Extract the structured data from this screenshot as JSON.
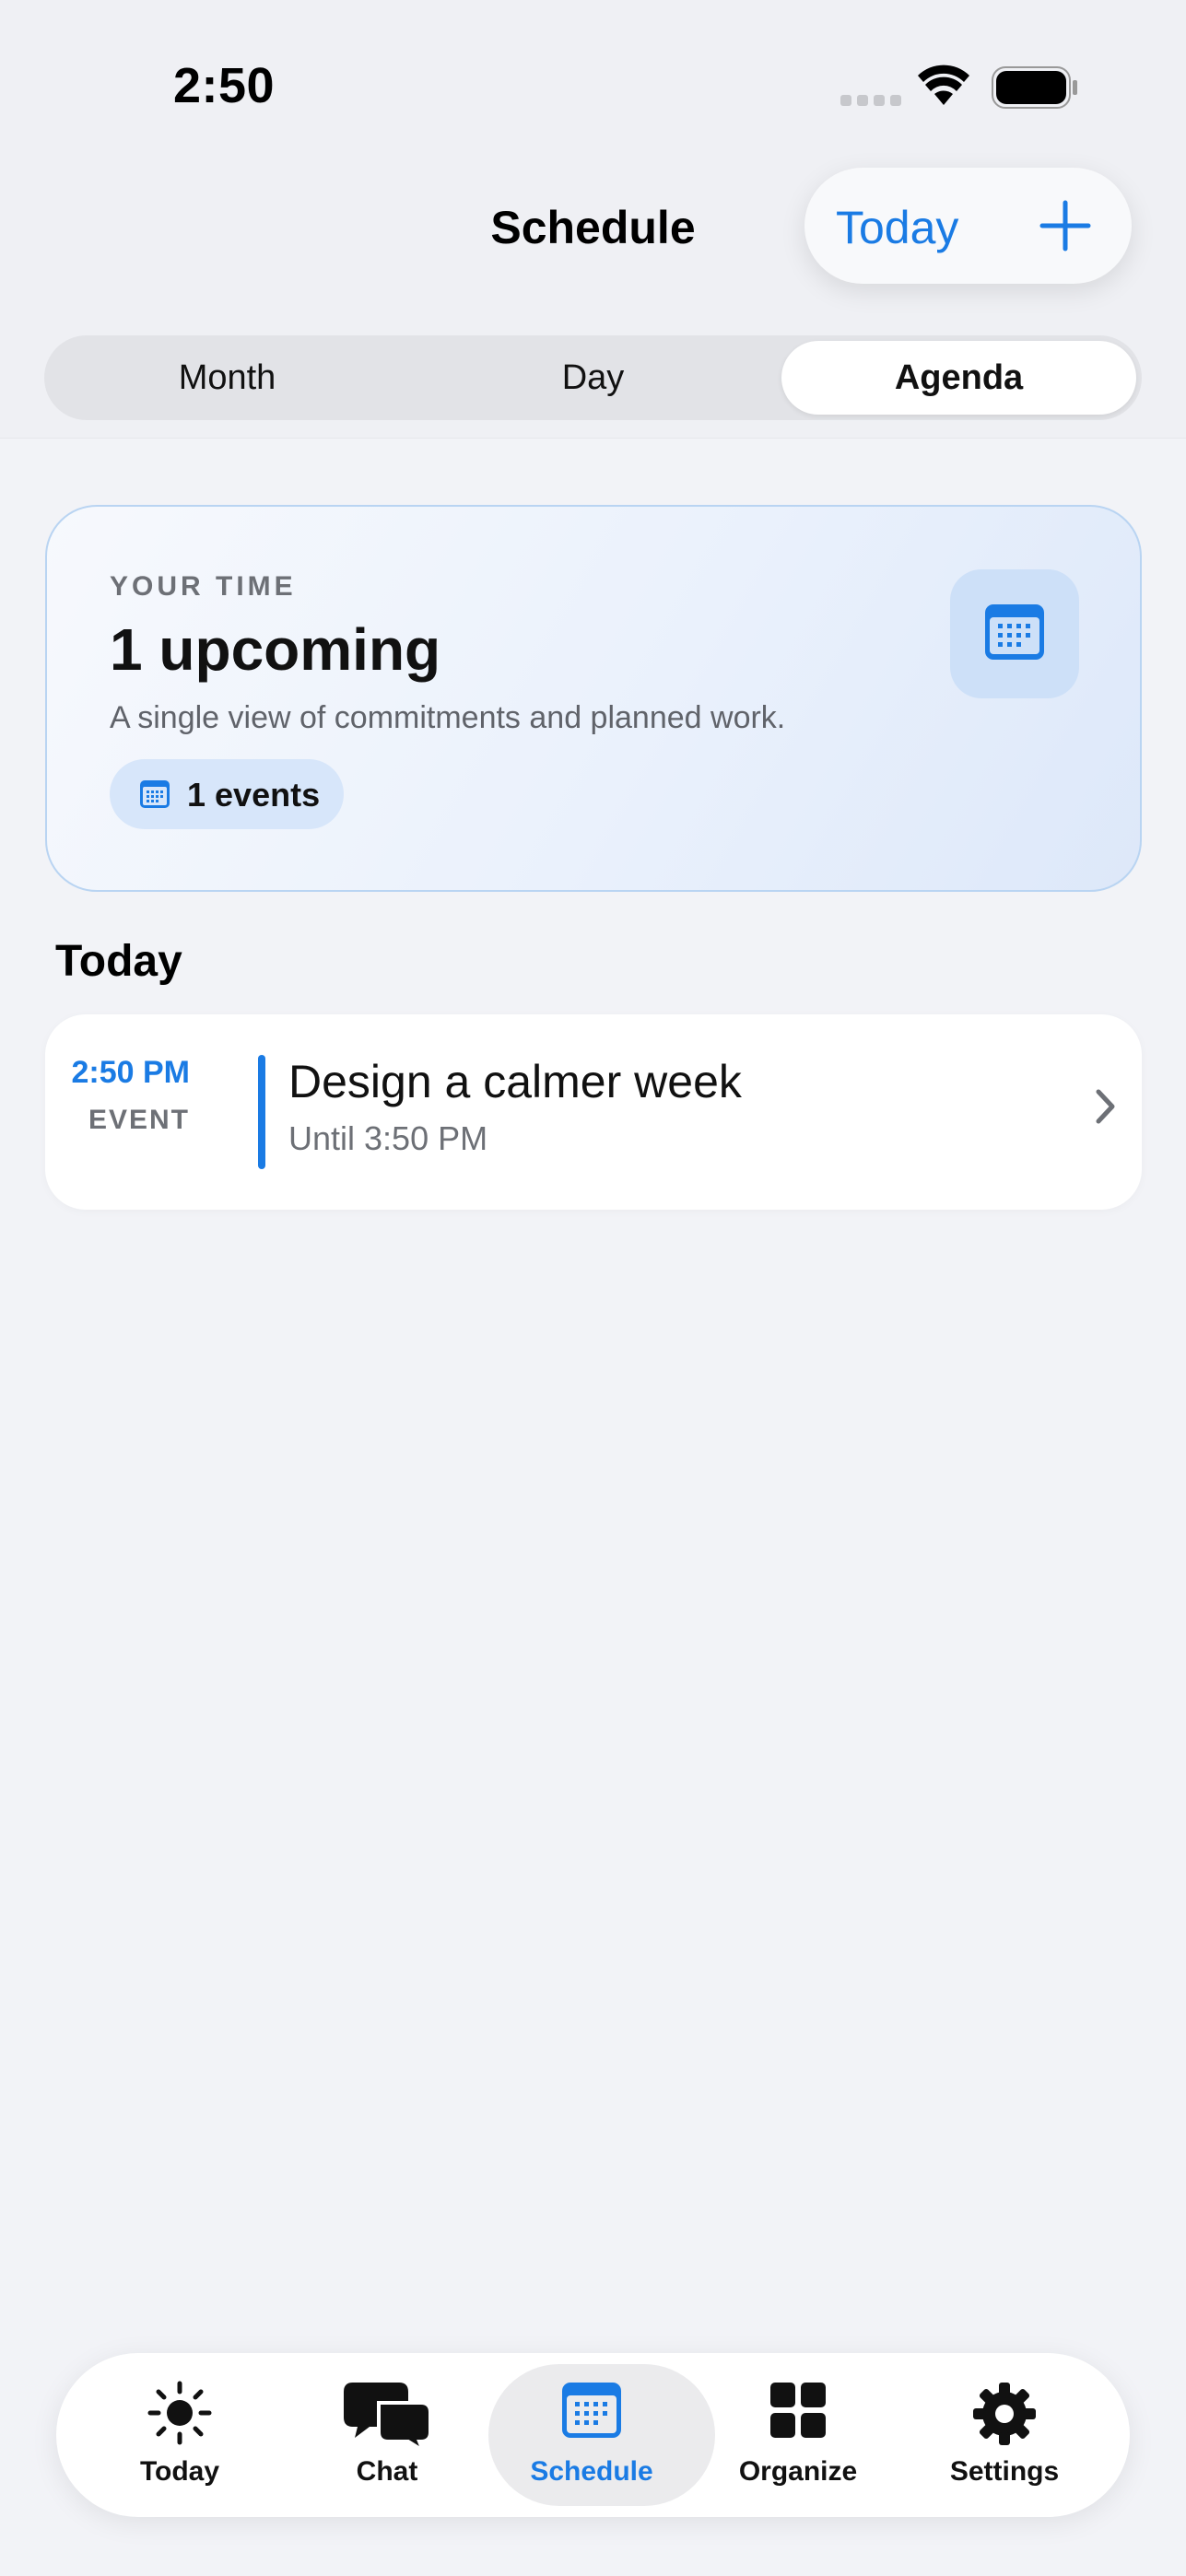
{
  "status_bar": {
    "time": "2:50"
  },
  "header": {
    "title": "Schedule",
    "today_button": "Today"
  },
  "view_switcher": {
    "options": [
      "Month",
      "Day",
      "Agenda"
    ],
    "selected": "Agenda"
  },
  "summary": {
    "eyebrow": "YOUR TIME",
    "count_text": "1 upcoming",
    "subtitle": "A single view of commitments and planned work.",
    "chip_label": "1 events"
  },
  "agenda": {
    "section_title": "Today",
    "events": [
      {
        "time": "2:50 PM",
        "kind": "EVENT",
        "title": "Design a calmer week",
        "until": "Until 3:50 PM"
      }
    ]
  },
  "tab_bar": {
    "tabs": [
      {
        "label": "Today",
        "icon": "sun-icon"
      },
      {
        "label": "Chat",
        "icon": "chat-bubbles-icon"
      },
      {
        "label": "Schedule",
        "icon": "calendar-icon"
      },
      {
        "label": "Organize",
        "icon": "grid-icon"
      },
      {
        "label": "Settings",
        "icon": "gear-icon"
      }
    ],
    "active": "Schedule"
  },
  "colors": {
    "accent": "#1a7be4",
    "background": "#f2f3f7",
    "card_tint": "#dde8f9"
  }
}
